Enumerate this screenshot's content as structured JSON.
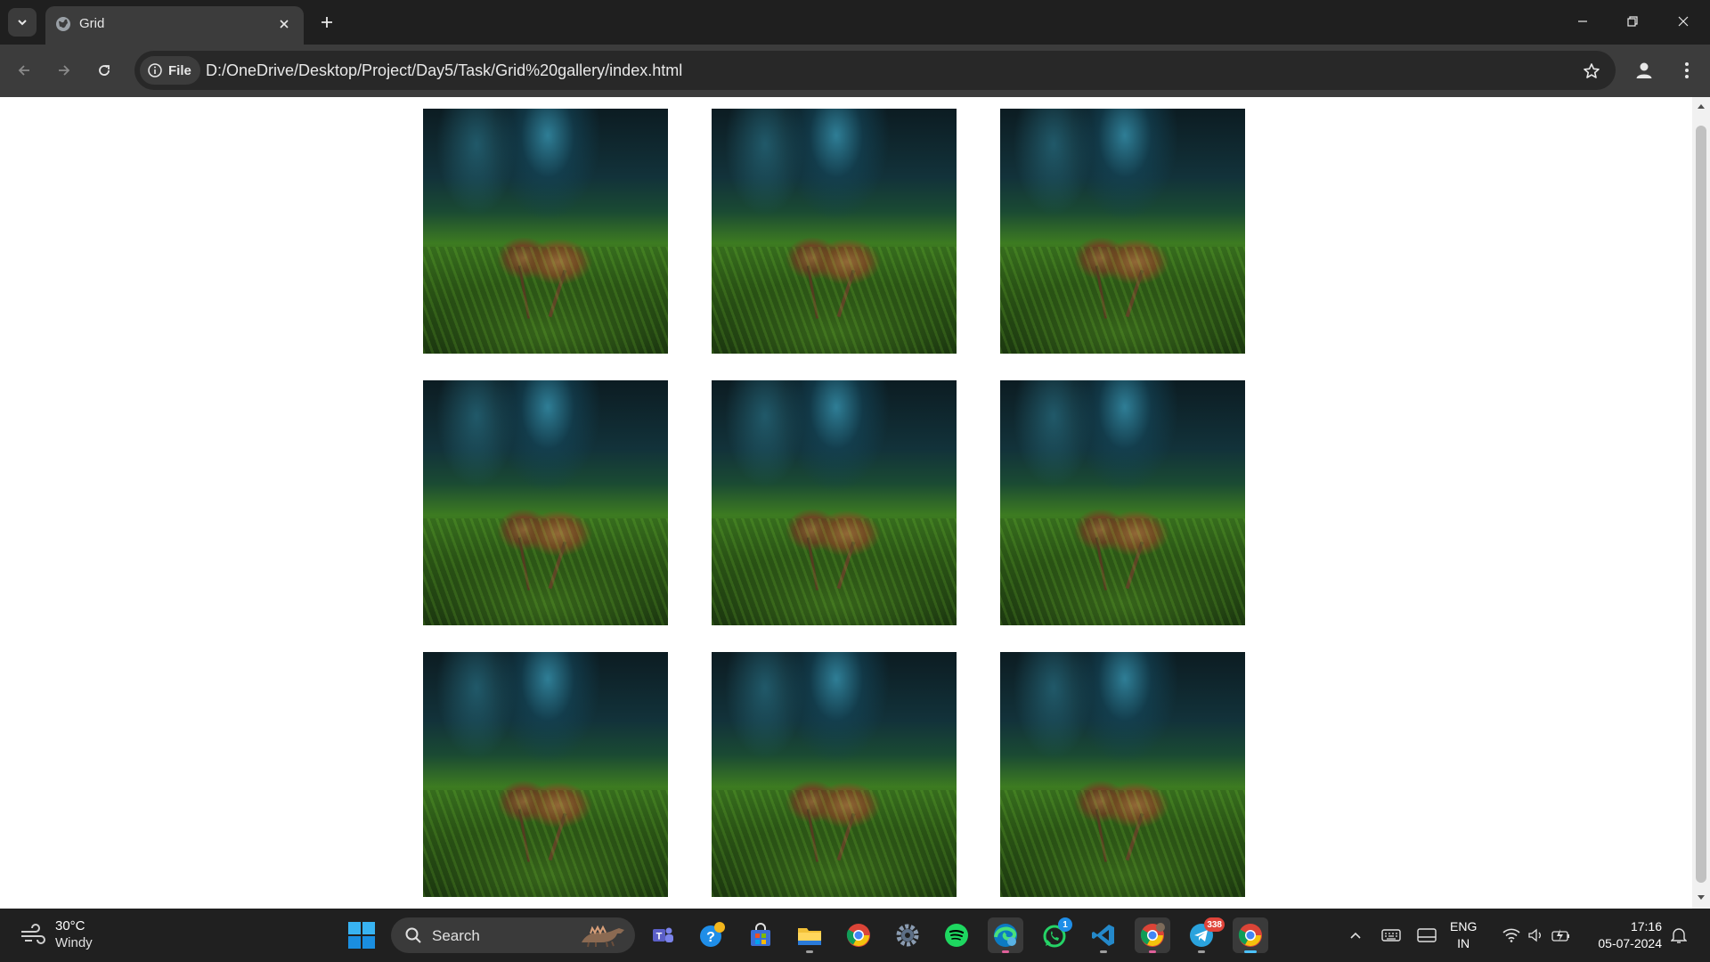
{
  "browser": {
    "tab": {
      "title": "Grid"
    },
    "address_bar": {
      "site_chip_label": "File",
      "url": "D:/OneDrive/Desktop/Project/Day5/Task/Grid%20gallery/index.html"
    },
    "icons": {
      "tab_search": "chevron-down-icon",
      "favicon": "globe-icon",
      "close": "close-icon",
      "new_tab": "plus-icon",
      "back": "arrow-left-icon",
      "forward": "arrow-right-icon",
      "reload": "reload-icon",
      "info": "info-icon",
      "bookmark": "star-icon",
      "profile": "person-icon",
      "menu": "kebab-menu-icon"
    }
  },
  "page": {
    "gallery": {
      "columns": 3,
      "rows": 3,
      "images": [
        {
          "subject": "mushroom on moss"
        },
        {
          "subject": "mushroom on moss"
        },
        {
          "subject": "mushroom on moss"
        },
        {
          "subject": "mushroom on moss"
        },
        {
          "subject": "mushroom on moss"
        },
        {
          "subject": "mushroom on moss"
        },
        {
          "subject": "mushroom on moss"
        },
        {
          "subject": "mushroom on moss"
        },
        {
          "subject": "mushroom on moss"
        }
      ]
    }
  },
  "taskbar": {
    "weather": {
      "temp": "30°C",
      "condition": "Windy"
    },
    "search": {
      "label": "Search"
    },
    "apps": [
      "teams-icon",
      "tips-icon",
      "store-icon",
      "file-explorer-icon",
      "chrome-icon",
      "settings-icon",
      "spotify-icon",
      "edge-icon",
      "whatsapp-icon",
      "vscode-icon",
      "chrome-profile-icon",
      "telegram-icon",
      "chrome-active-icon"
    ],
    "badges": {
      "whatsapp": "1",
      "telegram": "338"
    },
    "language": {
      "line1": "ENG",
      "line2": "IN"
    },
    "clock": {
      "time": "17:16",
      "date": "05-07-2024"
    }
  },
  "colors": {
    "titlebar": "#1f1f1f",
    "toolbar": "#3c3c3c",
    "taskbar": "#202020",
    "accent": "#4cc2ff"
  }
}
